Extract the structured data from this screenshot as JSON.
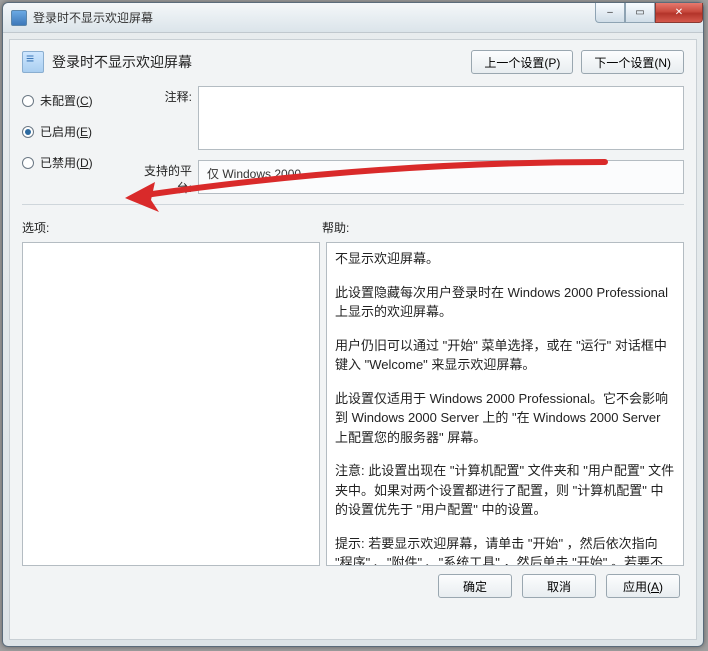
{
  "window": {
    "title": "登录时不显示欢迎屏幕"
  },
  "header": {
    "title": "登录时不显示欢迎屏幕",
    "prev_label": "上一个设置(P)",
    "next_label": "下一个设置(N)"
  },
  "radios": {
    "not_configured": "未配置(C)",
    "enabled": "已启用(E)",
    "disabled": "已禁用(D)",
    "selected": "enabled"
  },
  "fields": {
    "comment_label": "注释:",
    "comment_value": "",
    "platform_label": "支持的平台:",
    "platform_value": "仅 Windows 2000"
  },
  "panes": {
    "options_label": "选项:",
    "help_label": "帮助:",
    "help_paragraphs": [
      "不显示欢迎屏幕。",
      "此设置隐藏每次用户登录时在 Windows 2000 Professional 上显示的欢迎屏幕。",
      "用户仍旧可以通过 \"开始\" 菜单选择，或在 \"运行\" 对话框中键入 \"Welcome\" 来显示欢迎屏幕。",
      "此设置仅适用于 Windows 2000 Professional。它不会影响到 Windows 2000 Server 上的 \"在 Windows 2000 Server 上配置您的服务器\" 屏幕。",
      "注意: 此设置出现在 \"计算机配置\" 文件夹和 \"用户配置\" 文件夹中。如果对两个设置都进行了配置，则 \"计算机配置\" 中的设置优先于 \"用户配置\" 中的设置。",
      "提示: 若要显示欢迎屏幕，请单击 \"开始\" ，然后依次指向 \"程序\" 、\"附件\" 、\"系统工具\" ，然后单击 \"开始\" 。若要不想显示欢迎屏幕，而不指定设置，请清除欢迎屏幕上的 \"启动时显示此屏"
    ]
  },
  "footer": {
    "ok": "确定",
    "cancel": "取消",
    "apply": "应用(A)"
  }
}
